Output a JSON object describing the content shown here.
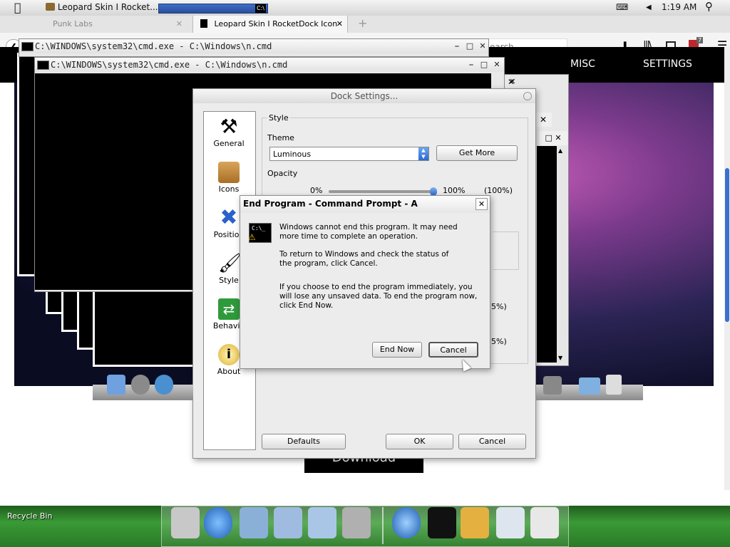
{
  "menubar": {
    "app_tab_title": "Leopard Skin I Rocket...",
    "cmd_label": "C:\\",
    "time": "1:19 AM"
  },
  "browser": {
    "tabs": [
      {
        "label": "Punk Labs"
      },
      {
        "label": "Leopard Skin I RocketDock Icon"
      }
    ],
    "search_placeholder": "earch",
    "ublock_count": "7",
    "site_nav": [
      "MISC",
      "SETTINGS"
    ],
    "download_label": "Download"
  },
  "cmd_windows": [
    {
      "title": "C:\\WINDOWS\\system32\\cmd.exe - C:\\Windows\\n.cmd"
    },
    {
      "title": "C:\\WINDOWS\\system32\\cmd.exe - C:\\Windows\\n.cmd"
    }
  ],
  "dock_settings": {
    "title": "Dock Settings...",
    "sidebar": [
      "General",
      "Icons",
      "Position",
      "Style",
      "Behavio",
      "About"
    ],
    "style_group": "Style",
    "theme_label": "Theme",
    "theme_value": "Luminous",
    "get_more": "Get More",
    "opacity_label": "Opacity",
    "opacity_min": "0%",
    "opacity_max": "100%",
    "opacity_value": "(100%)",
    "opacity_level": 1.0,
    "partial1": "5%)",
    "partial2": "5%)",
    "defaults": "Defaults",
    "ok": "OK",
    "cancel": "Cancel"
  },
  "end_program": {
    "title": "End Program - Command Prompt - A",
    "msg1": "Windows cannot end this program. It may need more time to complete an operation.",
    "msg2": "To return to Windows and check the status of the program, click Cancel.",
    "msg3": "If you choose to end the program immediately, you will lose any unsaved data. To end the program now, click End Now.",
    "end_now": "End Now",
    "cancel": "Cancel"
  },
  "desktop": {
    "recycle_bin": "Recycle Bin"
  }
}
